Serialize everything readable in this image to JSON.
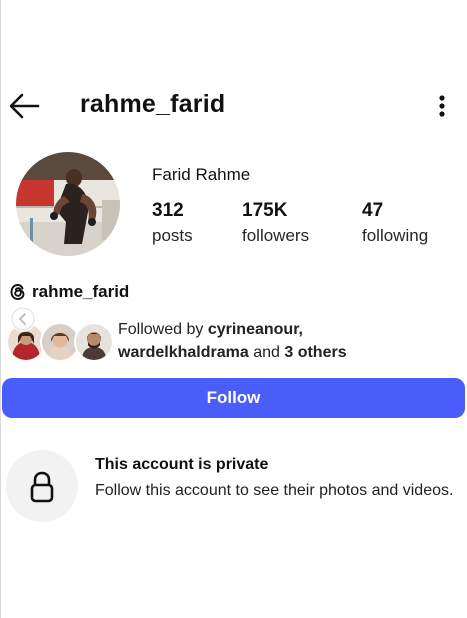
{
  "header": {
    "username": "rahme_farid",
    "back_icon": "arrow-left-icon",
    "menu_icon": "more-vertical-icon"
  },
  "profile": {
    "display_name": "Farid Rahme",
    "stats": [
      {
        "value": "312",
        "label": "posts"
      },
      {
        "value": "175K",
        "label": "followers"
      },
      {
        "value": "47",
        "label": "following"
      }
    ],
    "threads_handle": "rahme_farid",
    "threads_icon": "threads-icon"
  },
  "followed_by": {
    "prefix": "Followed by",
    "user1": "cyrineanour,",
    "user2": "wardelkhaldrama",
    "connector": "and",
    "others": "3 others"
  },
  "actions": {
    "follow_label": "Follow"
  },
  "private_notice": {
    "title": "This account is private",
    "description": "Follow this account to see their photos and videos.",
    "icon": "lock-icon"
  },
  "colors": {
    "accent": "#4a5df9",
    "lock_bg": "#f2f2f2"
  }
}
